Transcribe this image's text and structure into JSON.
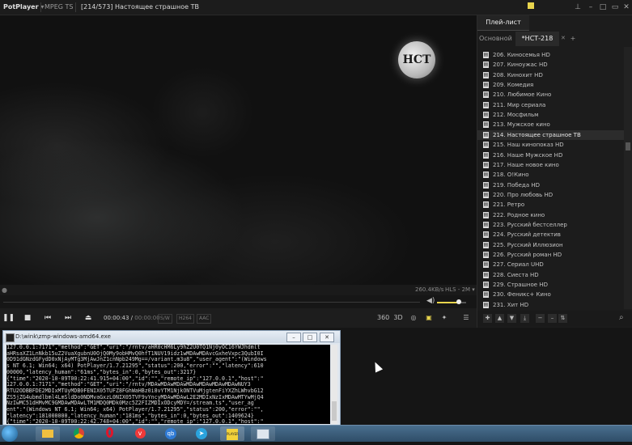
{
  "titlebar": {
    "app_name": "PotPlayer",
    "format": "MPEG TS",
    "title": "[214/573] Настоящее страшное ТВ",
    "icons": [
      "pin-icon",
      "minimize-icon",
      "maximize-icon",
      "close-icon",
      "list-icon"
    ]
  },
  "video": {
    "channel_logo": "НСТ"
  },
  "infobar": {
    "bitrate": "260.4KB/s",
    "protocol": "HLS - 2M ▾"
  },
  "controls": {
    "time_current": "00:00:43",
    "time_total": "00:00:00",
    "badges": [
      "S/W",
      "H264",
      "AAC"
    ],
    "volume_level": 0.75,
    "right_icons": [
      "360-icon",
      "3d-icon",
      "vr-icon",
      "capture-icon",
      "subtitle-icon",
      "settings-icon",
      "menu-icon"
    ]
  },
  "playlist": {
    "tab_label": "Плей-лист",
    "subtabs": [
      "Основной",
      "*НСТ-218",
      "+"
    ],
    "active_index": 8,
    "items": [
      "206. Киносемья HD",
      "207. Киноужас HD",
      "208. Кинохит HD",
      "209. Комедия",
      "210. Любимое Кино",
      "211. Мир сериала",
      "212. Мосфильм",
      "213. Мужское кино",
      "214. Настоящее страшное ТВ",
      "215. Наш кинопоказ HD",
      "216. Наше Мужское HD",
      "217. Наше новое кино",
      "218. О!Кино",
      "219. Победа HD",
      "220. Про любовь HD",
      "221. Ретро",
      "222. Родное кино",
      "223. Русский бестселлер",
      "224. Русский детектив",
      "225. Русский Иллюзион",
      "226. Русский роман HD",
      "227. Сериал UHD",
      "228. Сиеста HD",
      "229. Страшное HD",
      "230. Феникс+ Кино",
      "231. Хит HD"
    ],
    "toolbar_icons": [
      "add-icon",
      "up-icon",
      "down-icon",
      "move-bottom-icon",
      "remove-icon",
      "minus-icon",
      "sort-icon",
      "search-icon"
    ]
  },
  "console": {
    "title": "D:\\wink\\zmp-windows-amd64.exe",
    "lines": [
      "127.0.0.1:7171\",\"method\":\"GET\",\"uri\":\"/rntv/aHR0cHM6Ly9hZ2U0TQ1Nj0yOC16YWJhdmlt",
      "aHRsaXZ1LnNkb15uZ2VuaXgubnU0OjQ0My9obHMvQ0hfT1NUV19idz1wMDAwMDAvcGxheVxpc3QubI0I",
      "0D91dGNzdGFydD0xNjAyMTg3MjAwJnZ1cnNpb249Mg==/variant.m3u8\",\"user_agent\":\"(Windows",
      "s NT 6.1; Win64; x64) PotPlayer/1.7.21295\",\"status\":200,\"error\":\"\",\"latency\":610",
      "00000,\"latency_human\":\"61ms\",\"bytes_in\":0,\"bytes_out\":3217}",
      "{\"time\":\"2020-10-09T00:22:41.915+04:00\",\"id\":\"\",\"remote_ip\":\"127.0.0.1\",\"host\":\"",
      "127.0.0.1:7171\",\"method\":\"GET\",\"uri\":\"/rntv/MDAwMDAwMDAwMDAwMDAwMDAwMDAwNUY3",
      "RTU2ODBBFDE2MDIxMTUyMDB0FENIX05TUFZ8FGhWaHBz0i8vYTM1NjkONTVuMjgtenFiYXZhLWhvbG12",
      "ZS5jZG4ubmdlbml4LmSldDo0NDMvaGxzL0NIX05TVF9vYncyMDAwMDAwL2E2MDIxNzIxMDAwMTYwMjQ4",
      "NzIwMC51dHMvMC9GMDAwMDAwLTM1MDQ0MDk0Mzc5Z2FIZMDIxODcyMDY=/stream.ts\",\"user_ag",
      "ent\":\"(Windows NT 6.1; Win64; x64) PotPlayer/1.7.21295\",\"status\":200,\"error\":\"\",",
      "\"latency\":181000000,\"latency_human\":\"181ms\",\"bytes_in\":0,\"bytes_out\":1409624}",
      "{\"time\":\"2020-10-09T00:22:42.748+04:00\",\"id\":\"\",\"remote_ip\":\"127.0.0.1\",\"host\":\""
    ]
  },
  "taskbar": {
    "items": [
      "start-orb",
      "explorer-icon",
      "chrome-icon",
      "opera-icon",
      "vivaldi-icon",
      "qbittorrent-icon",
      "telegram-icon",
      "potplayer-icon",
      "app-icon"
    ],
    "potplayer_label": "PLAYER"
  }
}
